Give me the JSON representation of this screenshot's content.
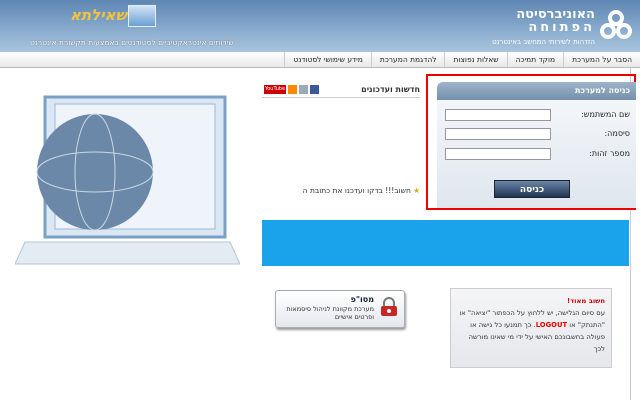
{
  "header": {
    "university_name_line1": "האוניברסיטה",
    "university_name_line2": "הפתוחה",
    "university_subtitle": "הזדהות לשירותי המחשב באינטרנט",
    "app_logo": "שאילתא",
    "app_subtitle": "שירותים אינטראקטיביים לסטודנטים באמצעות תקשורת אינטרנט"
  },
  "nav": {
    "items": [
      "הסבר על המערכת",
      "מוקד תמיכה",
      "שאלות נפוצות",
      "להדגמת המערכת",
      "מידע שימושי לסטודנט"
    ]
  },
  "news": {
    "title": "חדשות ועדכונים",
    "social": [
      "facebook-icon",
      "email-icon",
      "rss-icon",
      "youtube-icon"
    ],
    "youtube_label": "YouTube",
    "item": "חשוב!!! בדקו ועדכנו את כתובת ה"
  },
  "login": {
    "title": "כניסה למערכת",
    "username_label": "שם המשתמש:",
    "password_label": "סיסמה:",
    "id_label": "מספר זהות:",
    "username_value": "",
    "password_value": "",
    "id_value": "",
    "submit_label": "כניסה"
  },
  "mosop": {
    "title": "מסו\"פ",
    "description": "מערכת מקוונת לניהול סיסמאות ופרטים אישיים"
  },
  "notice": {
    "title": "חשוב מאוד!",
    "text_before": "עם סיום הגלישה, יש ללחוץ על הכפתור \"יציאה\" או \"התנתק\" או ",
    "logout": "LOGOUT",
    "text_after": ". כך תמנעו כל גישה או פעולה בחשבונכם האישי על ידי מי שאינו מורשה לכך"
  },
  "colors": {
    "header": "#7aa0c6",
    "highlight": "#ee0000",
    "banner": "#1aa3eb",
    "button": "#2a4060"
  }
}
